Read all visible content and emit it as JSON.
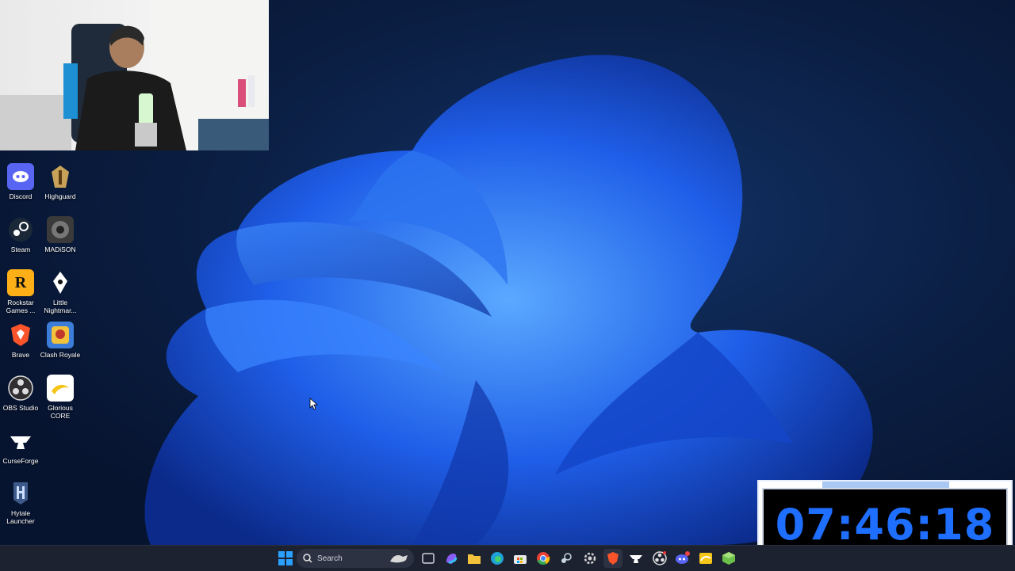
{
  "desktop": {
    "icons": [
      {
        "label": "Discord",
        "icon": "discord-icon",
        "color": "#5865F2"
      },
      {
        "label": "Highguard",
        "icon": "highguard-icon",
        "color": "#c9a25a"
      },
      {
        "label": "Steam",
        "icon": "steam-icon",
        "color": "#1b2838"
      },
      {
        "label": "MADiSON",
        "icon": "madison-icon",
        "color": "#3a3a3a"
      },
      {
        "label": "Rockstar Games ...",
        "icon": "rockstar-icon",
        "color": "#fcaf17"
      },
      {
        "label": "Little Nightmar...",
        "icon": "little-nightmares-icon",
        "color": "#1a1a1a"
      },
      {
        "label": "Brave",
        "icon": "brave-icon",
        "color": "#fb542b"
      },
      {
        "label": "Clash Royale",
        "icon": "clash-royale-icon",
        "color": "#3b7dd8"
      },
      {
        "label": "OBS Studio",
        "icon": "obs-icon",
        "color": "#302e31"
      },
      {
        "label": "Glorious CORE",
        "icon": "glorious-core-icon",
        "color": "#f5c518"
      },
      {
        "label": "CurseForge",
        "icon": "curseforge-icon",
        "color": "#f16436"
      },
      {
        "label": "Hytale Launcher",
        "icon": "hytale-icon",
        "color": "#3d5a8a"
      }
    ]
  },
  "taskbar": {
    "search_label": "Search",
    "apps": [
      {
        "name": "start-icon",
        "color": "#2aa0ff"
      },
      {
        "name": "task-view-icon",
        "color": "#cfd3dc"
      },
      {
        "name": "copilot-icon",
        "color": "#8a5cf6"
      },
      {
        "name": "file-explorer-icon",
        "color": "#f3c23c"
      },
      {
        "name": "edge-icon",
        "color": "#1fa0d8"
      },
      {
        "name": "store-icon",
        "color": "#e8e8e8"
      },
      {
        "name": "chrome-icon",
        "color": "#ea4335"
      },
      {
        "name": "steam-icon",
        "color": "#c7d5e0"
      },
      {
        "name": "settings-icon",
        "color": "#d0d0d0"
      },
      {
        "name": "brave-icon",
        "color": "#fb542b"
      },
      {
        "name": "curseforge-icon",
        "color": "#ffffff"
      },
      {
        "name": "obs-icon",
        "color": "#e0e0e0"
      },
      {
        "name": "discord-icon",
        "color": "#5865F2"
      },
      {
        "name": "glorious-core-icon",
        "color": "#f5c518"
      },
      {
        "name": "hytale-icon",
        "color": "#6cc04a"
      }
    ]
  },
  "clock_overlay": {
    "time": "07:46:18",
    "accent": "#1e6fff"
  }
}
